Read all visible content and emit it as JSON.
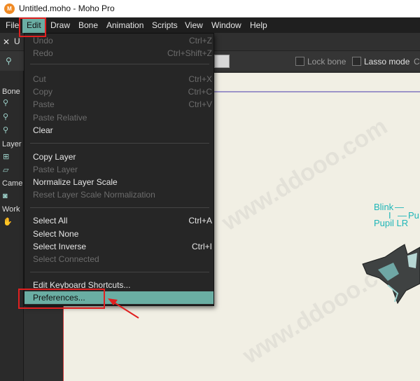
{
  "window": {
    "title": "Untitled.moho - Moho Pro",
    "app_icon": "moho-icon"
  },
  "menubar": {
    "items": [
      "File",
      "Edit",
      "Draw",
      "Bone",
      "Animation",
      "Scripts",
      "View",
      "Window",
      "Help"
    ],
    "active": "Edit"
  },
  "doc": {
    "tab_label": "U"
  },
  "toolbar": {
    "lock_bone": "Lock bone",
    "lasso_mode": "Lasso mode",
    "trailing": "C"
  },
  "sidebar": {
    "sections": [
      "Bone",
      "Layer",
      "Came",
      "Work"
    ]
  },
  "edit_menu": {
    "items": [
      {
        "label": "Undo",
        "shortcut": "Ctrl+Z",
        "enabled": false
      },
      {
        "label": "Redo",
        "shortcut": "Ctrl+Shift+Z",
        "enabled": false
      },
      {
        "label": "Cut",
        "shortcut": "Ctrl+X",
        "enabled": false
      },
      {
        "label": "Copy",
        "shortcut": "Ctrl+C",
        "enabled": false
      },
      {
        "label": "Paste",
        "shortcut": "Ctrl+V",
        "enabled": false
      },
      {
        "label": "Paste Relative",
        "shortcut": "",
        "enabled": false
      },
      {
        "label": "Clear",
        "shortcut": "",
        "enabled": true
      },
      {
        "label": "Copy Layer",
        "shortcut": "",
        "enabled": true
      },
      {
        "label": "Paste Layer",
        "shortcut": "",
        "enabled": false
      },
      {
        "label": "Normalize Layer Scale",
        "shortcut": "",
        "enabled": true
      },
      {
        "label": "Reset Layer Scale Normalization",
        "shortcut": "",
        "enabled": false
      },
      {
        "label": "Select All",
        "shortcut": "Ctrl+A",
        "enabled": true
      },
      {
        "label": "Select None",
        "shortcut": "",
        "enabled": true
      },
      {
        "label": "Select Inverse",
        "shortcut": "Ctrl+I",
        "enabled": true
      },
      {
        "label": "Select Connected",
        "shortcut": "",
        "enabled": false
      },
      {
        "label": "Edit Keyboard Shortcuts...",
        "shortcut": "",
        "enabled": true
      },
      {
        "label": "Preferences...",
        "shortcut": "",
        "enabled": true,
        "selected": true
      }
    ]
  },
  "canvas": {
    "bone_labels": [
      "Blink",
      "Pupil LR",
      "Pu"
    ]
  },
  "watermark": {
    "text": "www.ddooo.com"
  },
  "colors": {
    "accent": "#6aaea3",
    "highlight_box": "#e02020",
    "bone_label": "#1fb6b8"
  }
}
